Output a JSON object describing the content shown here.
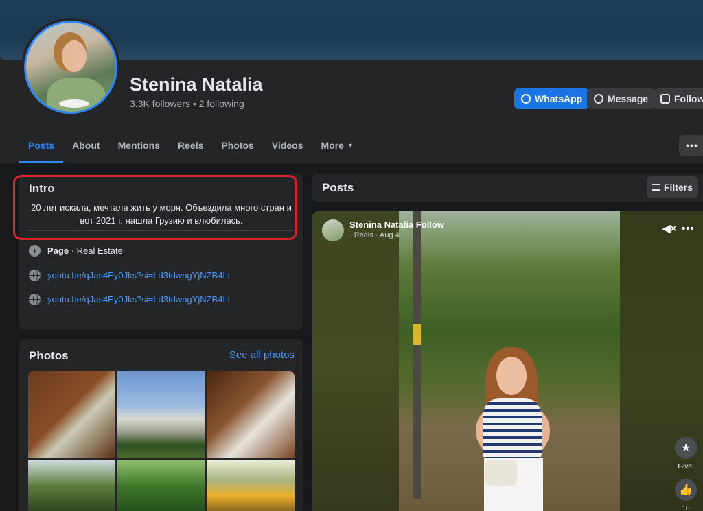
{
  "profile": {
    "name": "Stenina Natalia",
    "followers": "3.3K followers",
    "following": "2 following"
  },
  "actions": {
    "whatsapp": "WhatsApp",
    "message": "Message",
    "follow": "Follow",
    "more_dots": "•••"
  },
  "tabs": [
    "Posts",
    "About",
    "Mentions",
    "Reels",
    "Photos",
    "Videos",
    "More"
  ],
  "intro": {
    "title": "Intro",
    "bio": "20 лет искала, мечтала жить у моря. Объездила много стран и вот 2021 г. нашла Грузию и влюбилась.",
    "page_label": "Page",
    "page_category": " · Real Estate",
    "links": [
      "youtu.be/qJas4Ey0Jks?si=Ld3tdwngYjNZB4Lt",
      "youtu.be/qJas4Ey0Jks?si=Ld3tdwngYjNZB4Lt"
    ]
  },
  "photos": {
    "title": "Photos",
    "see_all": "See all photos"
  },
  "posts": {
    "title": "Posts",
    "filters": "Filters",
    "reel": {
      "author": "Stenina Natalia Follow",
      "meta": "· Reels · Aug 4 ·",
      "give_label": "Give!",
      "like_count": "10"
    }
  },
  "colors": {
    "accent": "#2d88ff",
    "primary_button": "#1b74e4",
    "highlight_box": "#e0202a",
    "background": "#18191a",
    "card": "#242526"
  }
}
